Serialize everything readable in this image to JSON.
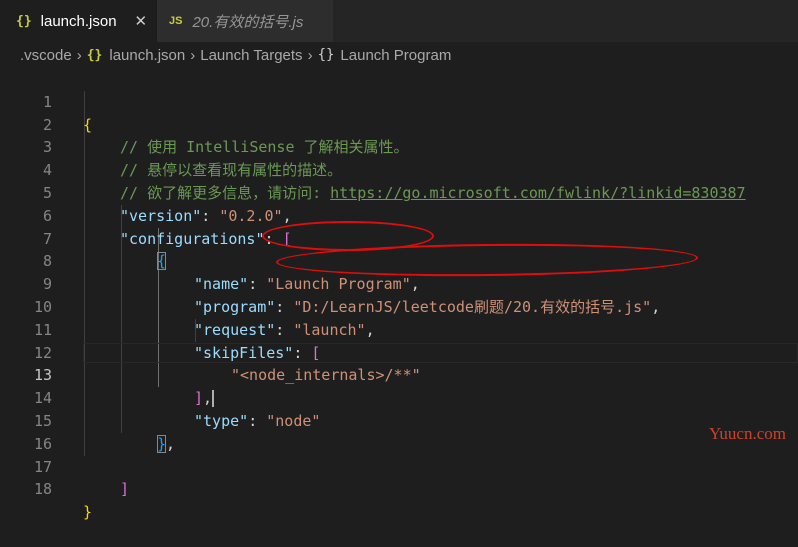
{
  "tabs": [
    {
      "icon": "{}",
      "label": "launch.json",
      "close": "✕"
    },
    {
      "icon": "JS",
      "label": "20.有效的括号.js"
    }
  ],
  "breadcrumb": {
    "folder": ".vscode",
    "sep": "›",
    "file_icon": "{}",
    "file": "launch.json",
    "section": "Launch Targets",
    "symbol_icon": "{}",
    "symbol": "Launch Program"
  },
  "editor": {
    "line_numbers": [
      "1",
      "2",
      "3",
      "4",
      "5",
      "6",
      "7",
      "8",
      "9",
      "10",
      "11",
      "12",
      "13",
      "14",
      "15",
      "16",
      "17",
      "18"
    ],
    "current_line": "13",
    "code": {
      "l1_brace": "{",
      "l2_comment": "// 使用 IntelliSense 了解相关属性。",
      "l3_comment": "// 悬停以查看现有属性的描述。",
      "l4_comment": "// 欲了解更多信息，请访问: ",
      "l4_link": "https://go.microsoft.com/fwlink/?linkid=830387",
      "version_key": "\"version\"",
      "version_val": "\"0.2.0\"",
      "configurations_key": "\"configurations\"",
      "arr_open": "[",
      "obj_open": "{",
      "name_key": "\"name\"",
      "name_val": "\"Launch Program\"",
      "program_key": "\"program\"",
      "program_val": "\"D:/LearnJS/leetcode刷题/20.有效的括号.js\"",
      "request_key": "\"request\"",
      "request_val": "\"launch\"",
      "skip_key": "\"skipFiles\"",
      "skip_open": "[",
      "skip_val": "\"<node_internals>/**\"",
      "skip_close": "]",
      "type_key": "\"type\"",
      "type_val": "\"node\"",
      "obj_close": "}",
      "arr_close": "]",
      "l18_brace": "}",
      "colon": ": ",
      "comma": ","
    }
  },
  "watermark": "Yuucn.com",
  "colors": {
    "key": "#9cdcfe",
    "string": "#ce9178",
    "comment": "#6a9955",
    "annotation": "#e00d0d"
  }
}
